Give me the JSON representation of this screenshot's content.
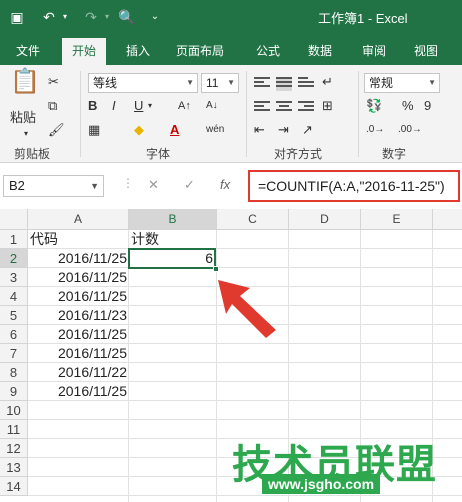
{
  "window": {
    "title": "工作簿1 - Excel"
  },
  "ribbon_tabs": [
    "文件",
    "开始",
    "插入",
    "页面布局",
    "公式",
    "数据",
    "审阅",
    "视图"
  ],
  "ribbon": {
    "clipboard": {
      "paste": "粘贴",
      "label": "剪贴板"
    },
    "font": {
      "name": "等线",
      "size": "11",
      "bold": "B",
      "italic": "I",
      "underline": "U",
      "color_a": "A",
      "label": "字体"
    },
    "alignment": {
      "label": "对齐方式"
    },
    "number": {
      "format": "常规",
      "percent": "%",
      "comma": "9",
      "label": "数字"
    }
  },
  "formula_bar": {
    "name_box": "B2",
    "cancel": "✕",
    "enter": "✓",
    "fx": "fx",
    "formula": "=COUNTIF(A:A,\"2016-11-25\")"
  },
  "columns": [
    "A",
    "B",
    "C",
    "D",
    "E"
  ],
  "rows": [
    "1",
    "2",
    "3",
    "4",
    "5",
    "6",
    "7",
    "8",
    "9",
    "10",
    "11",
    "12",
    "13",
    "14"
  ],
  "cells": {
    "A1": "代码",
    "B1": "计数",
    "A2": "2016/11/25",
    "B2": "6",
    "A3": "2016/11/25",
    "A4": "2016/11/25",
    "A5": "2016/11/23",
    "A6": "2016/11/25",
    "A7": "2016/11/25",
    "A8": "2016/11/22",
    "A9": "2016/11/25"
  },
  "watermark": {
    "text": "技术员联盟",
    "url": "www.jsgho.com"
  },
  "accent_color": "#217346",
  "highlight_color": "#e03a2e"
}
